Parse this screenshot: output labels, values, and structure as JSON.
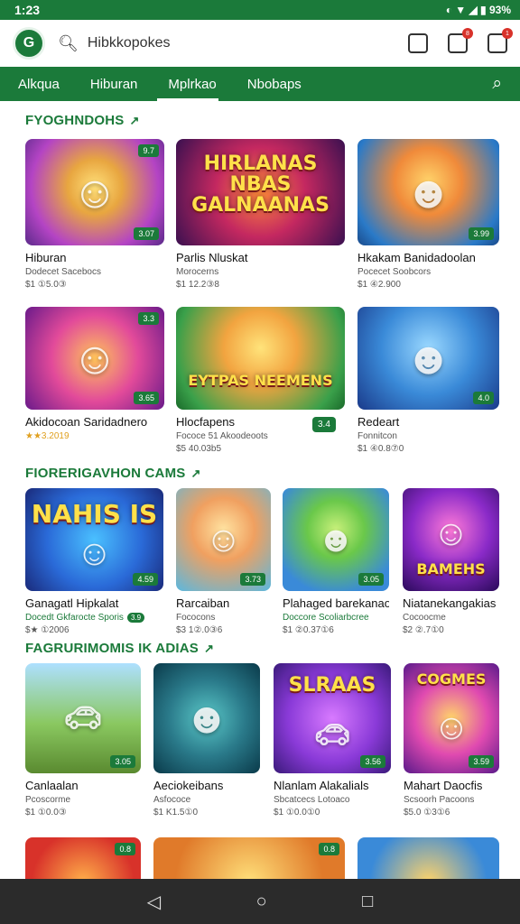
{
  "status": {
    "time": "1:23",
    "icons_text": "◐ ▼ ◢ ▮ 93%"
  },
  "header": {
    "logo_text": "G",
    "search_value": "Hibkkopokes",
    "actions": [
      {
        "icon": "camera-icon",
        "badge": ""
      },
      {
        "icon": "message-icon",
        "badge": "8"
      },
      {
        "icon": "bag-icon",
        "badge": "1"
      }
    ]
  },
  "tabs": [
    {
      "label": "Alkqua",
      "active": false
    },
    {
      "label": "Hiburan",
      "active": true
    },
    {
      "label": "Mplrkao",
      "active": true
    },
    {
      "label": "Nbobaps",
      "active": false
    }
  ],
  "sections": [
    {
      "title": "FYOGHNDOHS",
      "arrow": "↗"
    },
    {
      "title": "FIORERIGAVHON CAMS",
      "arrow": "↗"
    },
    {
      "title": "FAGRURIMOMIS IK ADIAS",
      "arrow": "↗"
    }
  ],
  "cards": [
    {
      "title": "Hiburan",
      "sub": "Dodecet Sacebocs",
      "price": "$1 ①5.0③",
      "tag": "9.7",
      "rating": "3.07"
    },
    {
      "title": "Parlis Nluskat",
      "sub": "Morocerns",
      "price": "$1 12.2③8",
      "art": "HIRLANAS NBAS GALNAANAS"
    },
    {
      "title": "Hkakam Banidadoolan",
      "sub": "Pocecet Soobcors",
      "price": "$1 ④2.900",
      "tag": "",
      "rating": "3.99"
    },
    {
      "title": "Akidocoan Saridadnero",
      "sub": "★★3.2019",
      "price": "",
      "tag": "3.3",
      "rating": "3.65"
    },
    {
      "title": "Hlocfapens",
      "sub": "Fococe 51 Akoodeoots",
      "price": "$5 40.03b5",
      "art": "EYTPAS NEEMENS",
      "badge": "3.4"
    },
    {
      "title": "Redeart",
      "sub": "Fonnitcon",
      "price": "$1 ④0.8⑦0",
      "tag": "",
      "rating": "4.0"
    },
    {
      "title": "Ganagatl Hipkalat",
      "sub": "Docedt Gkfarocte Sporis",
      "price": "$★ ①2006",
      "art": "NAHIS IS",
      "rating": "4.59",
      "pill": "3.9"
    },
    {
      "title": "Rarcaiban",
      "sub": "Fococons",
      "price": "$3 1②.0③6",
      "rating": "3.73"
    },
    {
      "title": "Plahaged barekanao",
      "sub": "Doccore Scoliarbcree",
      "price": "$1 ②0.37①6",
      "rating": "3.05"
    },
    {
      "title": "Niatanekangakias",
      "sub": "Cocoocme",
      "price": "$2 ②.7①0",
      "art": "BAMEHS"
    },
    {
      "title": "Canlaalan",
      "sub": "Pcoscorme",
      "price": "$1 ①0.0③",
      "tag": "",
      "rating": "3.05"
    },
    {
      "title": "Aeciokeibans",
      "sub": "Asfococe",
      "price": "$1 K1.5①0",
      "rating": ""
    },
    {
      "title": "Nlanlam Alakalials",
      "sub": "Sbcatcecs Lotoaco",
      "price": "$1 ①0.0①0",
      "art": "SLRAAS",
      "rating": "3.56"
    },
    {
      "title": "Mahart Daocfis",
      "sub": "Scsoorh Pacoons",
      "price": "$5.0 ①3①6",
      "art": "COGMES",
      "rating": "3.59"
    },
    {
      "title": "",
      "sub": "",
      "price": "",
      "tag": "0.8"
    },
    {
      "title": "",
      "sub": "",
      "price": "",
      "tag": "0.8"
    },
    {
      "title": "",
      "sub": "",
      "price": ""
    },
    {
      "title": "",
      "sub": "",
      "price": ""
    }
  ]
}
